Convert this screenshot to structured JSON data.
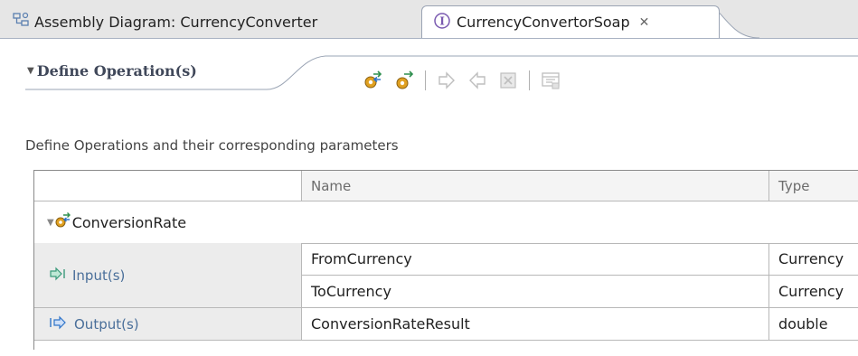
{
  "tabs": [
    {
      "label": "Assembly Diagram: CurrencyConverter",
      "icon": "assembly-diagram-icon",
      "active": false
    },
    {
      "label": "CurrencyConvertorSoap",
      "icon": "interface-icon",
      "active": true,
      "close_icon": "close-icon"
    }
  ],
  "section": {
    "title": "Define Operation(s)",
    "description": "Define Operations and their  corresponding parameters"
  },
  "toolbar": {
    "buttons": [
      {
        "icon": "add-request-response-operation-icon",
        "enabled": true
      },
      {
        "icon": "add-one-way-operation-icon",
        "enabled": true
      },
      {
        "icon": "add-input-icon",
        "enabled": false
      },
      {
        "icon": "add-output-icon",
        "enabled": false
      },
      {
        "icon": "add-fault-icon",
        "enabled": false
      },
      {
        "icon": "show-in-properties-icon",
        "enabled": false
      }
    ]
  },
  "table": {
    "columns": [
      "Name",
      "Type"
    ],
    "operation": {
      "name": "ConversionRate",
      "icon": "operation-icon"
    },
    "groups": {
      "input_label": "Input(s)",
      "output_label": "Output(s)"
    },
    "rows": [
      {
        "group": "input",
        "name": "FromCurrency",
        "type": "Currency"
      },
      {
        "group": "input",
        "name": "ToCurrency",
        "type": "Currency"
      },
      {
        "group": "output",
        "name": "ConversionRateResult",
        "type": "double"
      }
    ]
  },
  "colors": {
    "accent_blue": "#4a6f9a",
    "tab_bar": "#e6e6e6",
    "input_arrow": "#3a9a7a",
    "output_arrow": "#2f74c8"
  }
}
